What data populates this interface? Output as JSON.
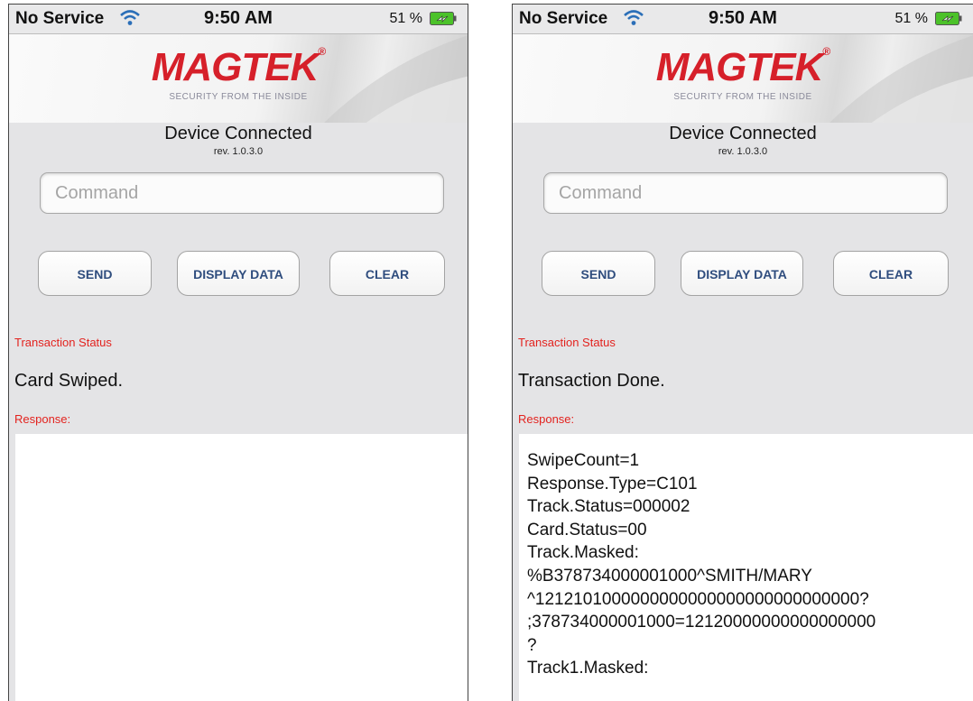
{
  "screens": [
    {
      "status_bar": {
        "carrier": "No Service",
        "time": "9:50 AM",
        "battery": "51 %"
      },
      "logo": {
        "name": "MAGTEK",
        "reg": "®",
        "tagline": "SECURITY FROM THE INSIDE"
      },
      "device_status": "Device Connected",
      "revision": "rev. 1.0.3.0",
      "command": {
        "placeholder": "Command",
        "value": ""
      },
      "buttons": {
        "send": "SEND",
        "display_data": "DISPLAY DATA",
        "clear": "CLEAR"
      },
      "transaction_status_label": "Transaction Status",
      "transaction_status": "Card Swiped.",
      "response_label": "Response:",
      "response_lines": []
    },
    {
      "status_bar": {
        "carrier": "No Service",
        "time": "9:50 AM",
        "battery": "51 %"
      },
      "logo": {
        "name": "MAGTEK",
        "reg": "®",
        "tagline": "SECURITY FROM THE INSIDE"
      },
      "device_status": "Device Connected",
      "revision": "rev. 1.0.3.0",
      "command": {
        "placeholder": "Command",
        "value": ""
      },
      "buttons": {
        "send": "SEND",
        "display_data": "DISPLAY DATA",
        "clear": "CLEAR"
      },
      "transaction_status_label": "Transaction Status",
      "transaction_status": "Transaction Done.",
      "response_label": "Response:",
      "response_lines": [
        "SwipeCount=1",
        "Response.Type=C101",
        "Track.Status=000002",
        "Card.Status=00",
        "Track.Masked:",
        "%B378734000001000^SMITH/MARY",
        "^1212101000000000000000000000000000?",
        ";378734000001000=12120000000000000000",
        "?",
        "Track1.Masked:"
      ]
    }
  ],
  "colors": {
    "logo_red": "#d6202a",
    "label_red": "#e3231f",
    "button_text": "#2f4d7e",
    "battery_green": "#4cc22a"
  },
  "icons": {
    "wifi": "wifi-icon",
    "battery": "battery-charging-icon"
  }
}
